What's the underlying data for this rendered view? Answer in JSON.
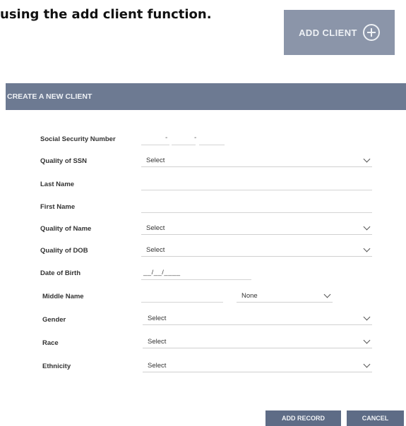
{
  "intro": {
    "text": "using the add client function."
  },
  "add_client_button": {
    "label": "ADD CLIENT",
    "icon": "plus-circle-icon"
  },
  "modal": {
    "title": "CREATE A NEW CLIENT",
    "fields": {
      "ssn": {
        "label": "Social Security Number",
        "separator": "-"
      },
      "ssn_quality": {
        "label": "Quality of SSN",
        "value": "Select"
      },
      "last_name": {
        "label": "Last Name",
        "value": ""
      },
      "first_name": {
        "label": "First Name",
        "value": ""
      },
      "name_quality": {
        "label": "Quality of Name",
        "value": "Select"
      },
      "dob_quality": {
        "label": "Quality of DOB",
        "value": "Select"
      },
      "dob": {
        "label": "Date of Birth",
        "mask": "__/__/____"
      },
      "middle_name": {
        "label": "Middle Name",
        "value": "",
        "suffix_value": "None"
      },
      "gender": {
        "label": "Gender",
        "value": "Select"
      },
      "race": {
        "label": "Race",
        "value": "Select"
      },
      "ethnicity": {
        "label": "Ethnicity",
        "value": "Select"
      }
    },
    "buttons": {
      "add_record": "ADD RECORD",
      "cancel": "CANCEL"
    }
  },
  "colors": {
    "header_bg": "#6d7a92",
    "button_bg": "#5e6c86",
    "add_client_bg": "#8b95a9"
  }
}
